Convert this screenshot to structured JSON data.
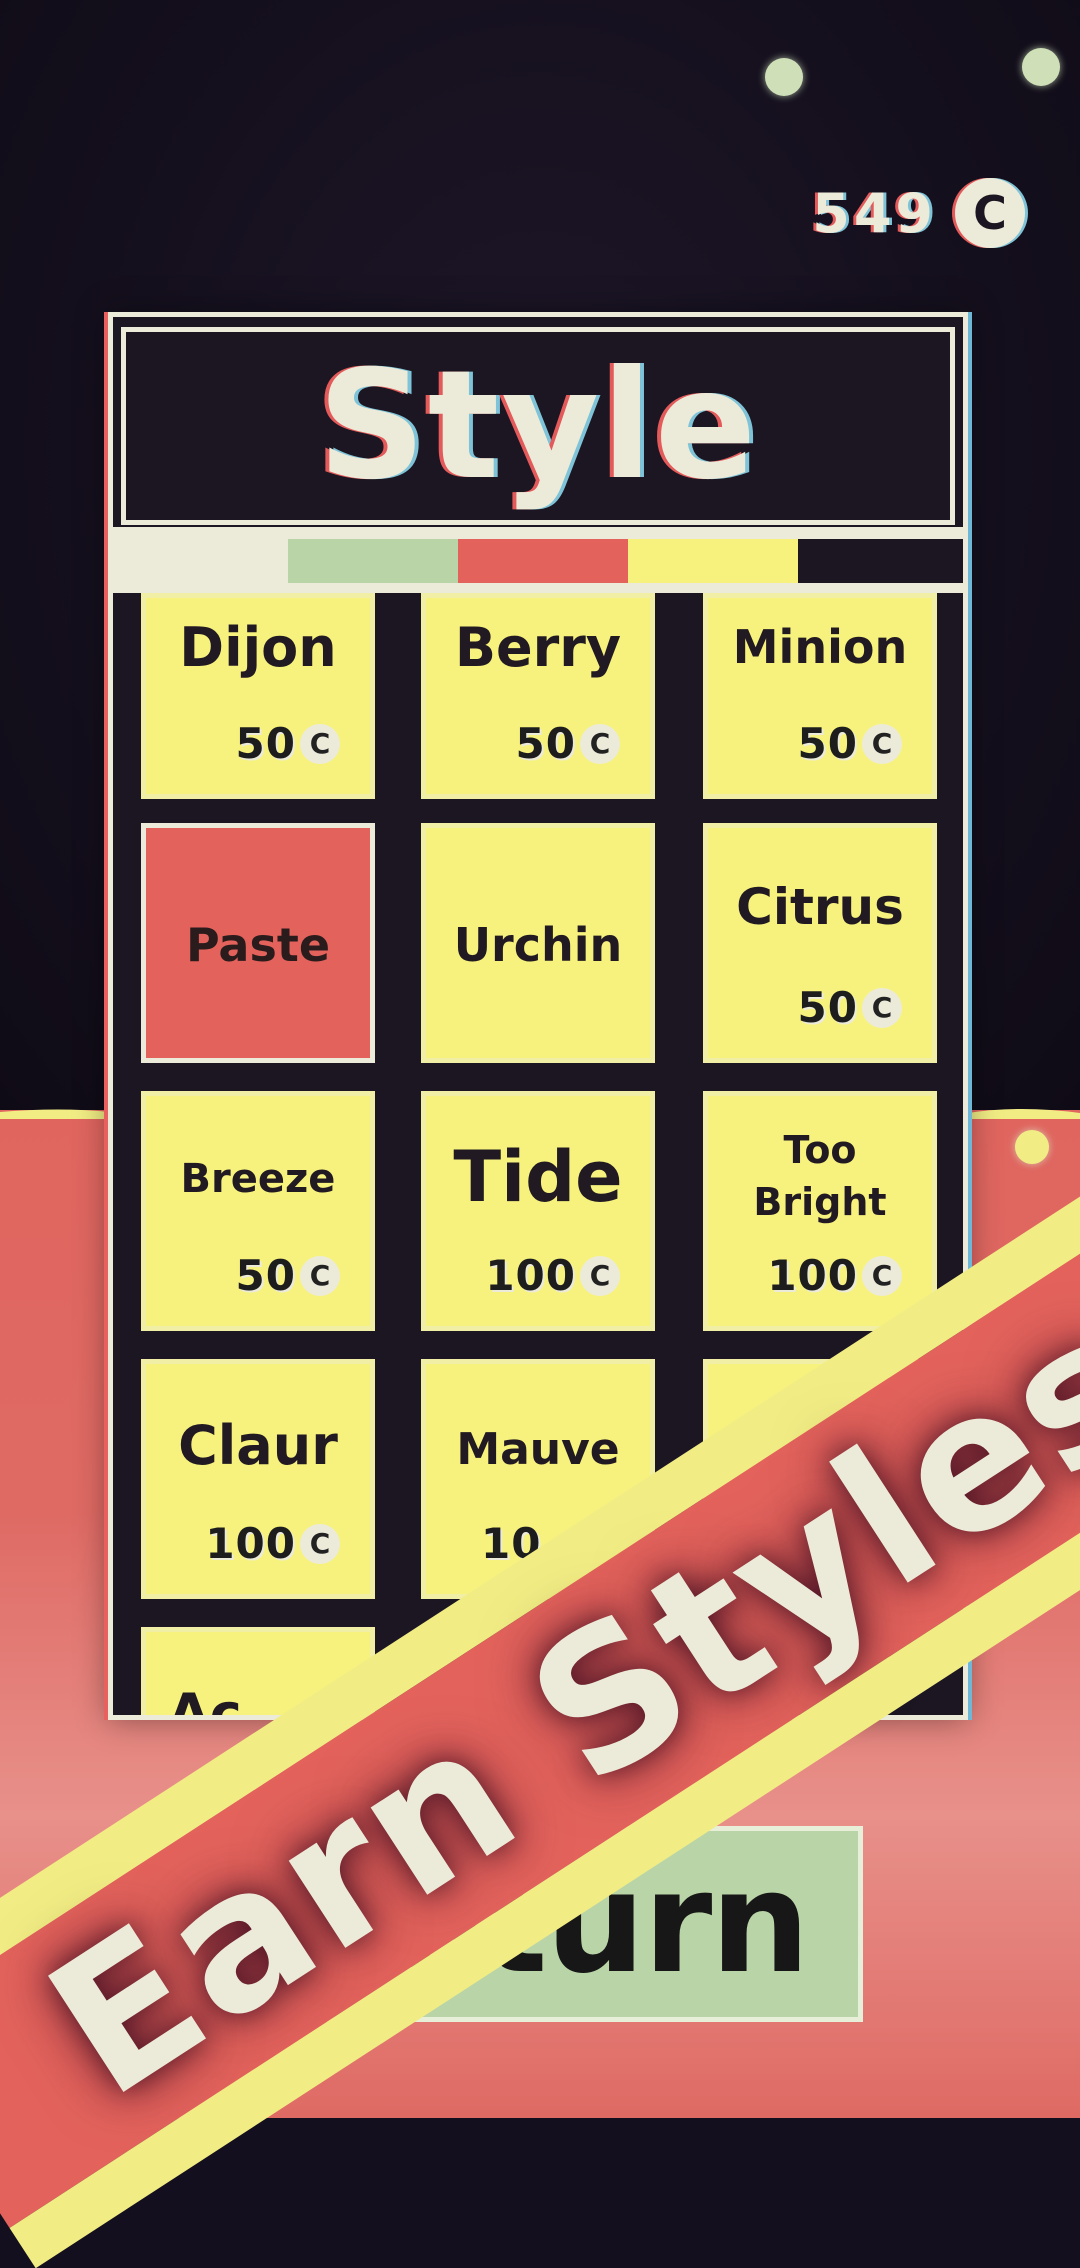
{
  "coins": {
    "value": "549",
    "icon": "coin-icon",
    "symbol": "C"
  },
  "screen_title": "Style",
  "palette": [
    {
      "name": "cream",
      "color": "#ecebd9"
    },
    {
      "name": "green",
      "color": "#b9d5a7"
    },
    {
      "name": "red",
      "color": "#e3625c"
    },
    {
      "name": "yellow",
      "color": "#f7f27e"
    },
    {
      "name": "dark",
      "color": "#1b1622"
    }
  ],
  "styles": [
    {
      "name": "Dijon",
      "price": "50",
      "currency": "C",
      "selected": false
    },
    {
      "name": "Berry",
      "price": "50",
      "currency": "C",
      "selected": false
    },
    {
      "name": "Minion",
      "price": "50",
      "currency": "C",
      "selected": false
    },
    {
      "name": "Paste",
      "price": "",
      "currency": "",
      "selected": true
    },
    {
      "name": "Urchin",
      "price": "",
      "currency": "",
      "selected": false
    },
    {
      "name": "Citrus",
      "price": "50",
      "currency": "C",
      "selected": false
    },
    {
      "name": "Breeze",
      "price": "50",
      "currency": "C",
      "selected": false
    },
    {
      "name": "Tide",
      "price": "100",
      "currency": "C",
      "selected": false
    },
    {
      "name": "Too Bright",
      "price": "100",
      "currency": "C",
      "selected": false
    },
    {
      "name": "Claur",
      "price": "100",
      "currency": "C",
      "selected": false
    },
    {
      "name": "Mauve",
      "price": "10",
      "currency": "",
      "selected": false
    },
    {
      "name": "",
      "price": "",
      "currency": "",
      "selected": false
    },
    {
      "name": "Ac",
      "price": "",
      "currency": "",
      "selected": false
    }
  ],
  "return_button": {
    "label": "eturn"
  },
  "banner": {
    "text": "Earn Styles"
  }
}
